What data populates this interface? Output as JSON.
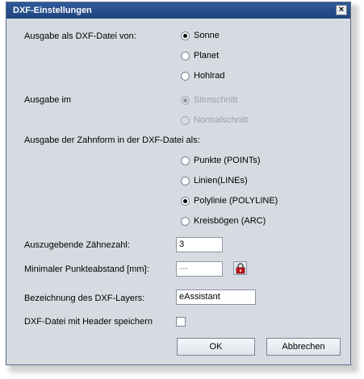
{
  "window": {
    "title": "DXF-Einstellungen",
    "close_label": "×"
  },
  "output_for": {
    "label": "Ausgabe als DXF-Datei von:",
    "options": [
      {
        "label": "Sonne",
        "selected": true
      },
      {
        "label": "Planet",
        "selected": false
      },
      {
        "label": "Hohlrad",
        "selected": false
      }
    ]
  },
  "output_in": {
    "label": "Ausgabe im",
    "options": [
      {
        "label": "Stirnschnitt",
        "selected": true,
        "disabled": true
      },
      {
        "label": "Normalschnitt",
        "selected": false,
        "disabled": true
      }
    ]
  },
  "tooth_form": {
    "label": "Ausgabe der Zahnform in der DXF-Datei als:",
    "options": [
      {
        "label": "Punkte (POINTs)",
        "selected": false
      },
      {
        "label": "Linien(LINEs)",
        "selected": false
      },
      {
        "label": "Polylinie (POLYLINE)",
        "selected": true
      },
      {
        "label": "Kreisbögen (ARC)",
        "selected": false
      }
    ]
  },
  "teeth_count": {
    "label": "Auszugebende Zähnezahl:",
    "value": "3"
  },
  "min_point_distance": {
    "label": "Minimaler Punkteabstand [mm]:",
    "value": "---",
    "lock_icon": "lock-icon",
    "lock_color": "#c0151b"
  },
  "layer_name": {
    "label": "Bezeichnung des DXF-Layers:",
    "value": "eAssistant"
  },
  "save_header": {
    "label": "DXF-Datei mit Header speichern",
    "checked": false
  },
  "buttons": {
    "ok": "OK",
    "cancel": "Abbrechen"
  },
  "colors": {
    "titlebar": "#2f5a99",
    "dialog_bg": "#d6dbe2"
  }
}
